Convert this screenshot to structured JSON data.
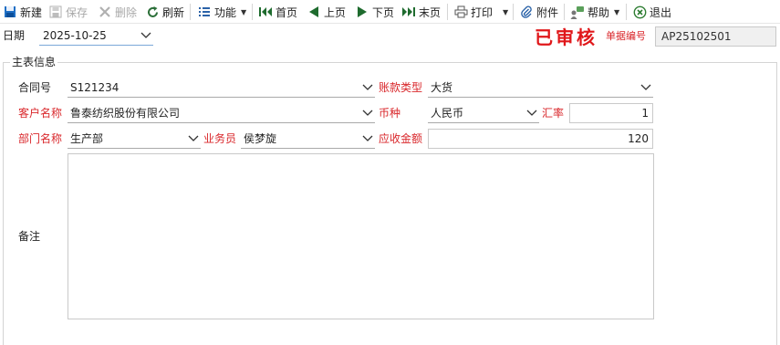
{
  "toolbar": {
    "new_label": "新建",
    "save_label": "保存",
    "delete_label": "删除",
    "refresh_label": "刷新",
    "functions_label": "功能",
    "first_label": "首页",
    "prev_label": "上页",
    "next_label": "下页",
    "last_label": "末页",
    "print_label": "打印",
    "attach_label": "附件",
    "help_label": "帮助",
    "exit_label": "退出"
  },
  "header": {
    "date_label": "日期",
    "date_value": "2025-10-25",
    "status_stamp": "已审核",
    "doc_no_label": "单据编号",
    "doc_no_value": "AP25102501"
  },
  "main": {
    "group_title": "主表信息",
    "contract_no_label": "合同号",
    "contract_no_value": "S121234",
    "payment_type_label": "账款类型",
    "payment_type_value": "大货",
    "customer_label": "客户名称",
    "customer_value": "鲁泰纺织股份有限公司",
    "currency_label": "币种",
    "currency_value": "人民币",
    "rate_label": "汇率",
    "rate_value": "1",
    "dept_label": "部门名称",
    "dept_value": "生产部",
    "salesman_label": "业务员",
    "salesman_value": "侯梦旋",
    "amount_label": "应收金额",
    "amount_value": "120",
    "remark_label": "备注",
    "remark_value": ""
  },
  "colors": {
    "required_label": "#d9262a",
    "stamp": "#e0171a",
    "nav_green": "#2e7d32"
  },
  "icons": [
    "new-icon",
    "save-icon",
    "delete-icon",
    "refresh-icon",
    "functions-icon",
    "first-page-icon",
    "prev-page-icon",
    "next-page-icon",
    "last-page-icon",
    "print-icon",
    "attachment-icon",
    "help-icon",
    "exit-icon",
    "chevron-down-icon"
  ]
}
